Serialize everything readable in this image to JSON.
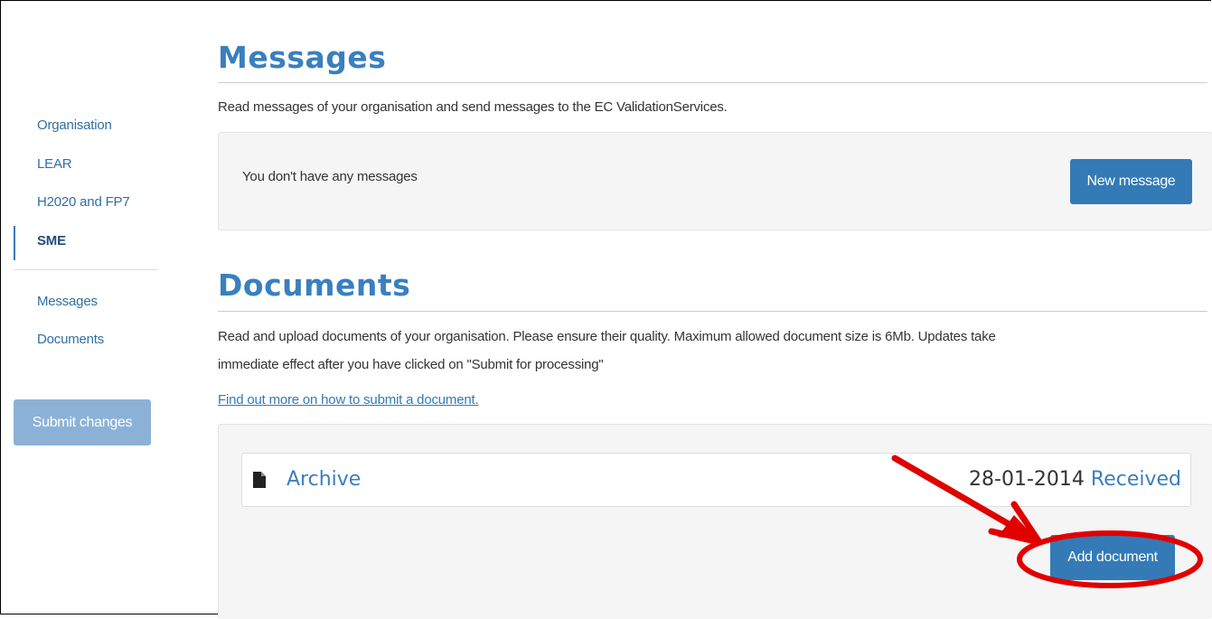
{
  "sidebar": {
    "items": [
      {
        "label": "Organisation"
      },
      {
        "label": "LEAR"
      },
      {
        "label": "H2020 and FP7"
      },
      {
        "label": "SME"
      },
      {
        "label": "Messages"
      },
      {
        "label": "Documents"
      }
    ],
    "submit_label": "Submit changes"
  },
  "messages": {
    "title": "Messages",
    "description": "Read messages of your organisation and send messages to the EC ValidationServices.",
    "empty_text": "You don't have any messages",
    "new_button": "New message"
  },
  "documents": {
    "title": "Documents",
    "description_line1": "Read and upload documents of your organisation. Please ensure their quality. Maximum allowed document size is 6Mb. Updates take",
    "description_line2": "immediate effect after you have clicked on \"Submit for processing\"",
    "help_link": "Find out more on how to submit a document.",
    "items": [
      {
        "name": "Archive",
        "date": "28-01-2014",
        "status": "Received"
      }
    ],
    "add_button": "Add document"
  },
  "colors": {
    "accent": "#337ab7",
    "title": "#3a7fbf",
    "annotation": "#e00000"
  },
  "icons": {
    "document": "file-icon"
  }
}
